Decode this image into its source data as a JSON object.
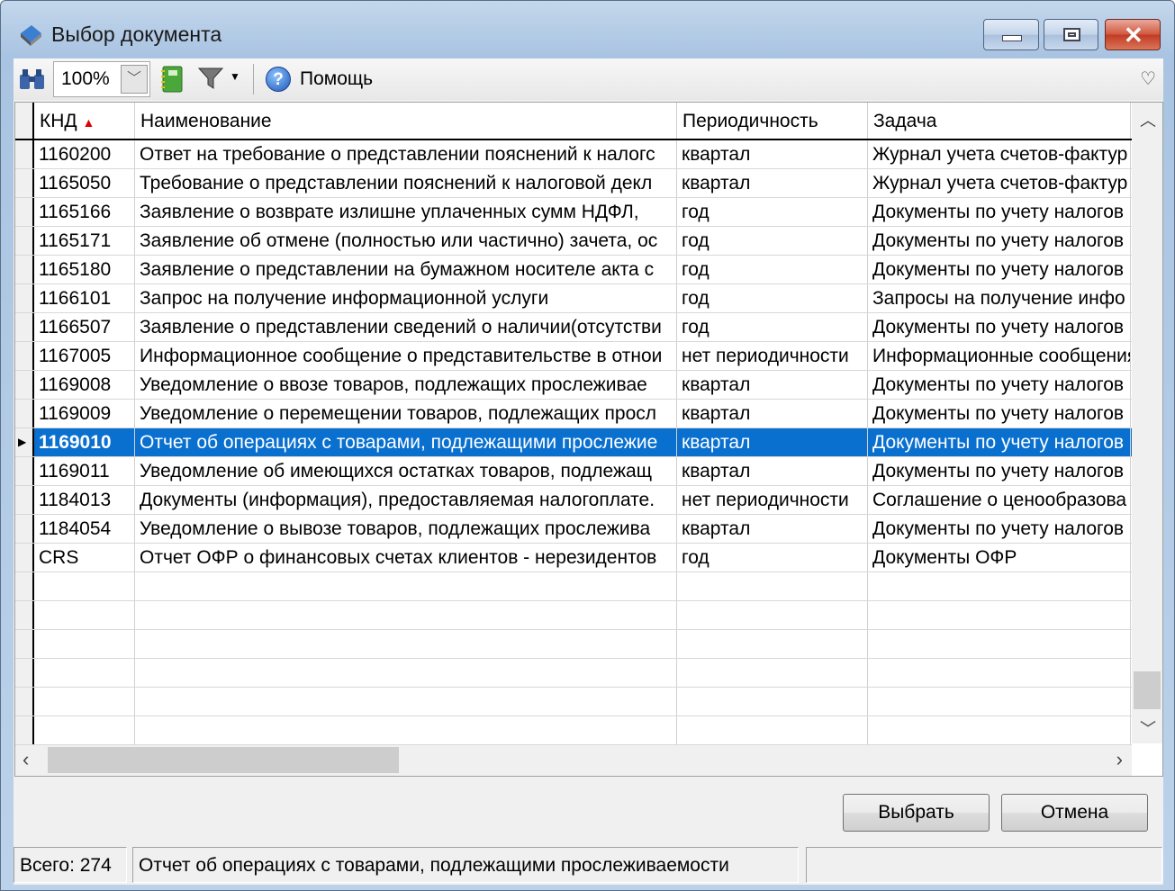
{
  "window": {
    "title": "Выбор документа"
  },
  "toolbar": {
    "zoom": "100%",
    "help_label": "Помощь"
  },
  "columns": [
    "КНД",
    "Наименование",
    "Периодичность",
    "Задача"
  ],
  "rows": [
    [
      "1160200",
      "Ответ на требование о представлении пояснений к налогс",
      "квартал",
      "Журнал учета счетов-фактур"
    ],
    [
      "1165050",
      "Требование о представлении пояснений к налоговой декл",
      "квартал",
      "Журнал учета счетов-фактур"
    ],
    [
      "1165166",
      "Заявление о возврате излишне уплаченных сумм НДФЛ,",
      "год",
      "Документы по учету налогов"
    ],
    [
      "1165171",
      "Заявление об отмене (полностью или частично) зачета, ос",
      "год",
      "Документы по учету налогов"
    ],
    [
      "1165180",
      "Заявление о представлении на бумажном носителе акта с",
      "год",
      "Документы по учету налогов"
    ],
    [
      "1166101",
      "Запрос на получение информационной услуги",
      "год",
      "Запросы на получение инфо"
    ],
    [
      "1166507",
      "Заявление о представлении сведений о наличии(отсутстви",
      "год",
      "Документы по учету налогов"
    ],
    [
      "1167005",
      "Информационное сообщение о представительстве в отнои",
      "нет периодичности",
      "Информационные сообщения"
    ],
    [
      "1169008",
      "Уведомление о ввозе товаров, подлежащих прослеживае",
      "квартал",
      "Документы по учету налогов"
    ],
    [
      "1169009",
      "Уведомление о перемещении товаров, подлежащих просл",
      "квартал",
      "Документы по учету налогов"
    ],
    [
      "1169010",
      "Отчет об операциях с товарами, подлежащими прослежие",
      "квартал",
      "Документы по учету налогов"
    ],
    [
      "1169011",
      "Уведомление об имеющихся остатках товаров, подлежащ",
      "квартал",
      "Документы по учету налогов"
    ],
    [
      "1184013",
      "Документы (информация), предоставляемая налогоплате.",
      "нет периодичности",
      "Соглашение о ценообразова"
    ],
    [
      "1184054",
      "Уведомление о вывозе товаров, подлежащих прослежива",
      "квартал",
      "Документы по учету налогов"
    ],
    [
      "CRS",
      "Отчет ОФР о финансовых счетах клиентов - нерезидентов",
      "год",
      "Документы ОФР"
    ]
  ],
  "selected_index": 10,
  "buttons": {
    "ok": "Выбрать",
    "cancel": "Отмена"
  },
  "status": {
    "total": "Всего: 274",
    "current": "Отчет об операциях с товарами, подлежащими прослеживаемости",
    "extra": ""
  },
  "colors": {
    "selection": "#0a70cf",
    "sort_arrow": "#e00000"
  }
}
